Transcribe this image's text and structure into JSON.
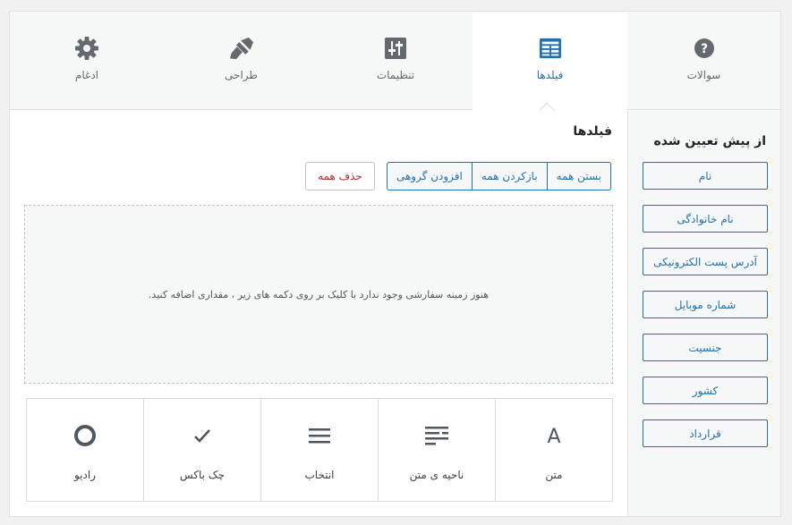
{
  "tabs": [
    {
      "label": "سوالات",
      "icon": "question-icon",
      "active": false
    },
    {
      "label": "فیلدها",
      "icon": "table-fields-icon",
      "active": true
    },
    {
      "label": "تنظیمات",
      "icon": "sliders-icon",
      "active": false
    },
    {
      "label": "طراحی",
      "icon": "paintbrush-icon",
      "active": false
    },
    {
      "label": "ادغام",
      "icon": "gear-icon",
      "active": false
    }
  ],
  "sidebar": {
    "title": "از پیش تعیین شده",
    "items": [
      {
        "label": "نام"
      },
      {
        "label": "نام خانوادگی"
      },
      {
        "label": "آدرس پست الکترونیکی"
      },
      {
        "label": "شماره موبایل"
      },
      {
        "label": "جنسیت"
      },
      {
        "label": "کشور"
      },
      {
        "label": "قرارداد"
      }
    ]
  },
  "main": {
    "title": "فیلدها",
    "buttons": {
      "collapse_all": "بستن همه",
      "expand_all": "بازکردن همه",
      "bulk_add": "افزودن گروهی",
      "delete_all": "حذف همه"
    },
    "empty_message": "هنوز زمینه سفارشی وجود ندارد با کلیک بر روی دکمه های زیر ، مقداری اضافه کنید."
  },
  "field_types": [
    {
      "label": "متن",
      "icon": "text-a-icon"
    },
    {
      "label": "ناحیه ی متن",
      "icon": "textarea-icon"
    },
    {
      "label": "انتخاب",
      "icon": "select-list-icon"
    },
    {
      "label": "چک باکس",
      "icon": "checkmark-icon"
    },
    {
      "label": "رادیو",
      "icon": "radio-icon"
    }
  ],
  "colors": {
    "accent": "#2271b1",
    "danger": "#b32d2e",
    "icon_gray": "#646970"
  }
}
